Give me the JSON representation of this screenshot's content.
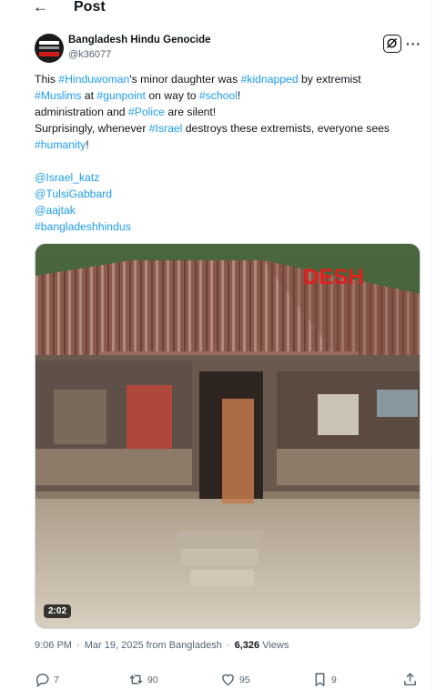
{
  "header": {
    "back_icon": "arrow-left-icon",
    "title": "Post"
  },
  "author": {
    "display_name": "Bangladesh Hindu Genocide",
    "handle": "@k36077",
    "avatar_colors": [
      "#1b1b1b",
      "#d11a1a"
    ]
  },
  "tweet": {
    "segments": [
      {
        "text": "This ",
        "link": false
      },
      {
        "text": "#Hinduwoman",
        "link": true
      },
      {
        "text": "'s minor daughter was ",
        "link": false
      },
      {
        "text": "#kidnapped",
        "link": true
      },
      {
        "text": " by extremist\n",
        "link": false
      },
      {
        "text": "#Muslims",
        "link": true
      },
      {
        "text": " at ",
        "link": false
      },
      {
        "text": "#gunpoint",
        "link": true
      },
      {
        "text": " on way to ",
        "link": false
      },
      {
        "text": "#school",
        "link": true
      },
      {
        "text": "!\n administration and ",
        "link": false
      },
      {
        "text": "#Police",
        "link": true
      },
      {
        "text": " are silent!\nSurprisingly, whenever ",
        "link": false
      },
      {
        "text": "#Israel",
        "link": true
      },
      {
        "text": " destroys these extremists, everyone sees\n",
        "link": false
      },
      {
        "text": "#humanity",
        "link": true
      },
      {
        "text": "!",
        "link": false
      }
    ],
    "mentions": [
      "@Israel_katz",
      "@TulsiGabbard",
      "@aajtak",
      "#bangladeshhindus"
    ]
  },
  "media": {
    "watermark": "DESH",
    "duration": "2:02"
  },
  "meta": {
    "time": "9:06 PM",
    "date": "Mar 19, 2025",
    "location": "from Bangladesh",
    "views": "6,326",
    "views_label": "Views"
  },
  "actions": {
    "replies": "7",
    "reposts": "90",
    "likes": "95",
    "bookmarks": "9"
  },
  "colors": {
    "link": "#1d9bf0",
    "secondary_text": "#536471"
  }
}
